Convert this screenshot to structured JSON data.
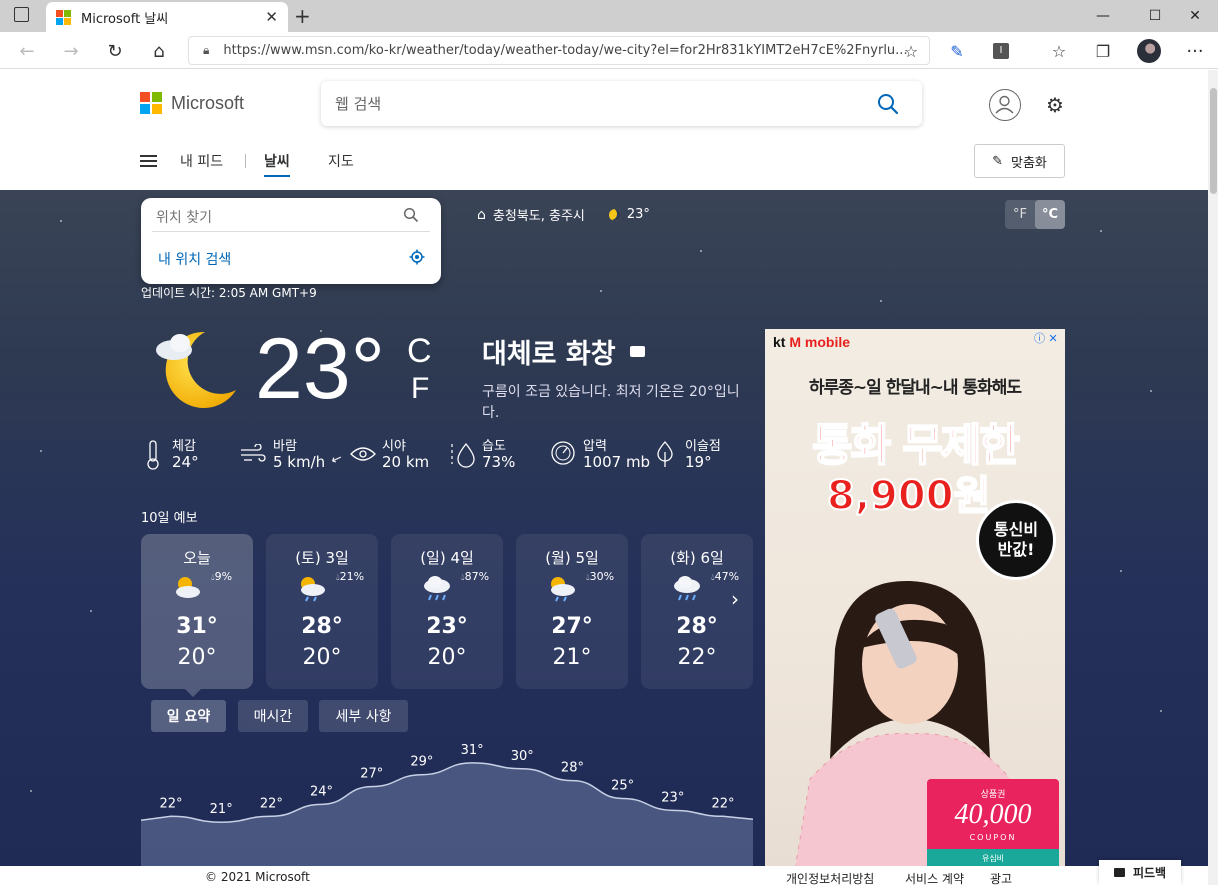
{
  "browser": {
    "tab_title": "Microsoft 날씨",
    "url": "https://www.msn.com/ko-kr/weather/today/weather-today/we-city?el=for2Hr831kYIMT2eH7cE%2Fnyrlu..."
  },
  "header": {
    "brand": "Microsoft",
    "search_placeholder": "웹 검색",
    "nav": [
      "내 피드",
      "날씨",
      "지도"
    ],
    "customize_label": "맞춤화"
  },
  "location": {
    "search_placeholder": "위치 찾기",
    "my_location_label": "내 위치 검색",
    "home_location": "충청북도, 충주시",
    "home_temp": "23°",
    "unit_f": "°F",
    "unit_c": "°C"
  },
  "current": {
    "updated": "업데이트 시간: 2:05 AM GMT+9",
    "temp": "23°",
    "unit_c": "C",
    "unit_f": "F",
    "condition": "대체로 화창",
    "description": "구름이 조금 있습니다. 최저 기온은 20°입니다.",
    "metrics": [
      {
        "label": "체감",
        "value": "24°",
        "icon": "thermometer-icon"
      },
      {
        "label": "바람",
        "value": "5 km/h",
        "icon": "wind-icon"
      },
      {
        "label": "시야",
        "value": "20 km",
        "icon": "eye-icon"
      },
      {
        "label": "습도",
        "value": "73%",
        "icon": "humidity-icon"
      },
      {
        "label": "압력",
        "value": "1007 mb",
        "icon": "pressure-icon"
      },
      {
        "label": "이슬점",
        "value": "19°",
        "icon": "dewpoint-icon"
      }
    ]
  },
  "forecast": {
    "title": "10일 예보",
    "days": [
      {
        "label": "오늘",
        "precip": "9%",
        "hi": "31°",
        "lo": "20°",
        "icon": "partly-sunny-icon"
      },
      {
        "label": "(토) 3일",
        "precip": "21%",
        "hi": "28°",
        "lo": "20°",
        "icon": "sun-rain-icon"
      },
      {
        "label": "(일) 4일",
        "precip": "87%",
        "hi": "23°",
        "lo": "20°",
        "icon": "rain-icon"
      },
      {
        "label": "(월) 5일",
        "precip": "30%",
        "hi": "27°",
        "lo": "21°",
        "icon": "sun-rain-icon"
      },
      {
        "label": "(화) 6일",
        "precip": "47%",
        "hi": "28°",
        "lo": "22°",
        "icon": "rain-icon"
      }
    ],
    "subtabs": [
      "일 요약",
      "매시간",
      "세부 사항"
    ]
  },
  "chart_data": {
    "type": "area",
    "values": [
      22,
      21,
      22,
      24,
      27,
      29,
      31,
      30,
      28,
      25,
      23,
      22
    ],
    "labels": [
      "22°",
      "21°",
      "22°",
      "24°",
      "27°",
      "29°",
      "31°",
      "30°",
      "28°",
      "25°",
      "23°",
      "22°"
    ]
  },
  "ad": {
    "brand_kt": "kt",
    "brand_m": "M mobile",
    "line1": "하루종~일 한달내~내 통화해도",
    "line2": "통화 무제한",
    "line3": "8,900원",
    "badge1": "통신비",
    "badge2": "반값!",
    "coupon_small": "상품권",
    "coupon_big": "40,000",
    "coupon_label": "COUPON",
    "coupon2": "유심비"
  },
  "footer": {
    "copyright": "© 2021 Microsoft",
    "links": [
      "개인정보처리방침",
      "서비스 계약",
      "광고"
    ],
    "feedback": "피드백"
  },
  "colors": {
    "accent": "#0067b8",
    "ad_red": "#e8211e",
    "coupon_pink": "#e8235e"
  }
}
